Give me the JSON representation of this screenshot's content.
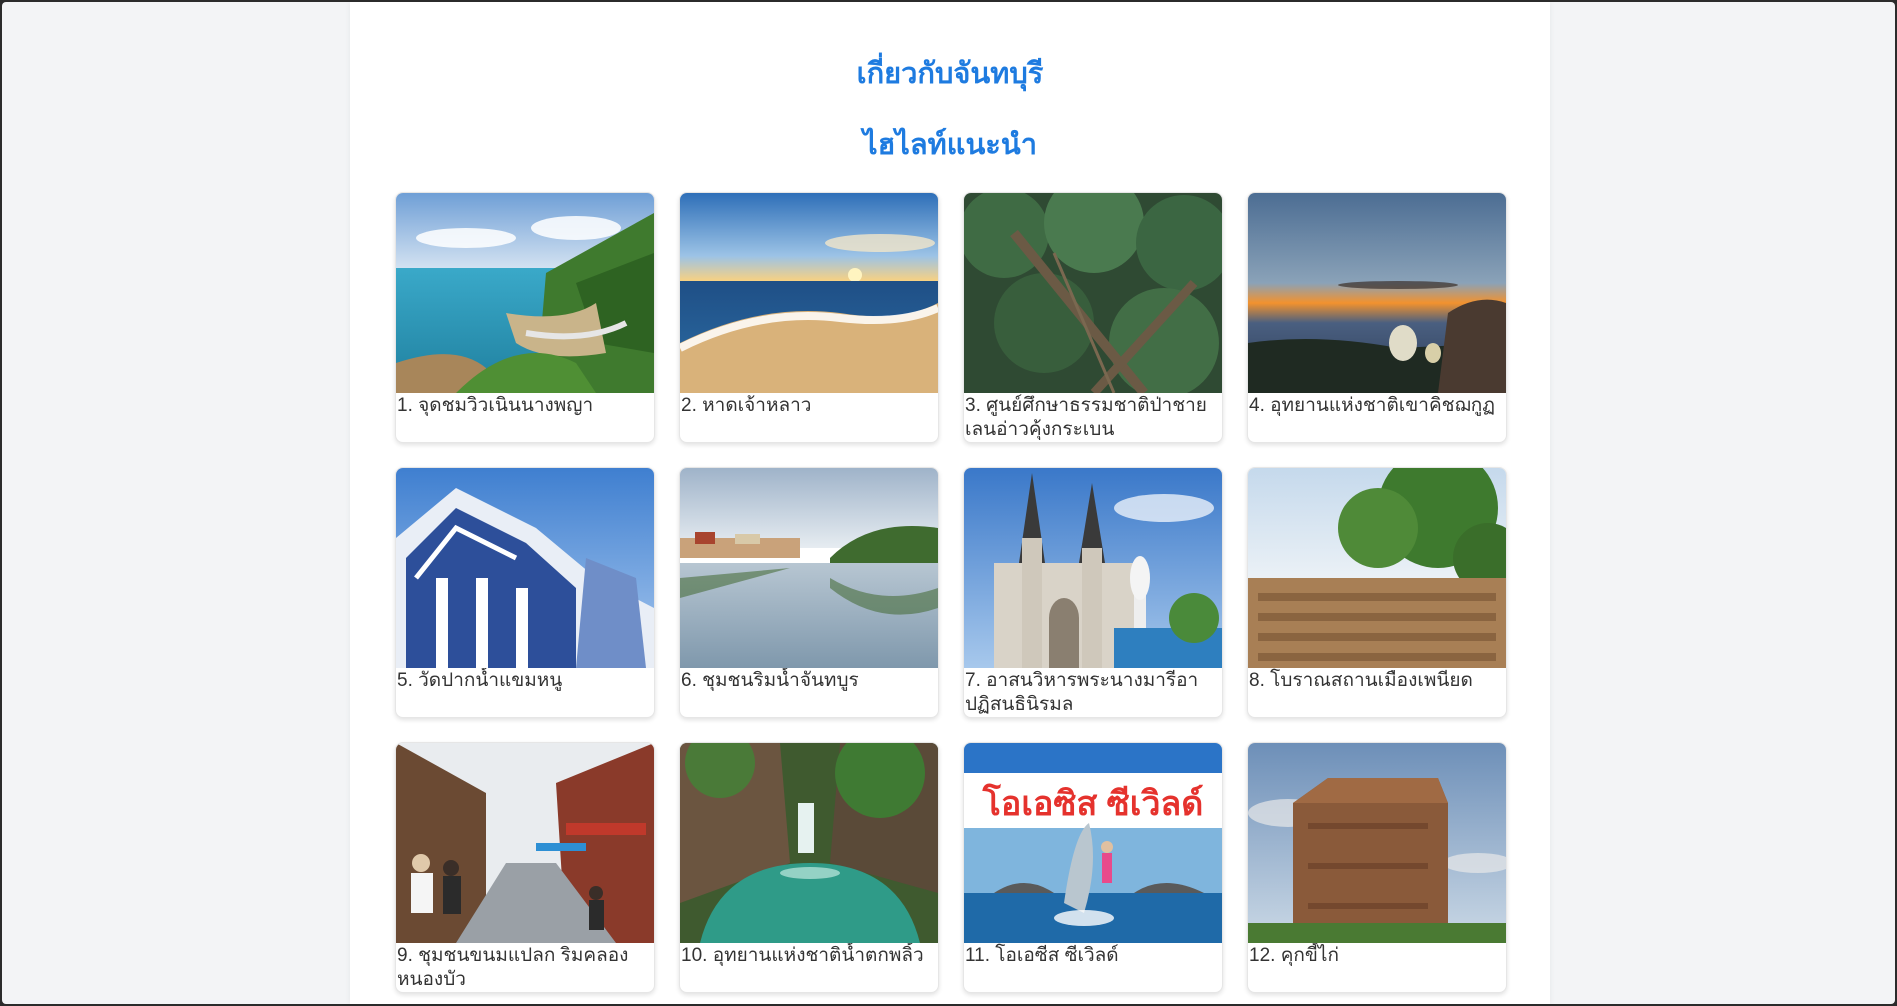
{
  "page": {
    "heading": "เกี่ยวกับจันทบุรี",
    "subheading": "ไฮไลท์แนะนำ"
  },
  "colors": {
    "heading": "#1e7be0",
    "label_text": "#333333",
    "page_bg": "#f3f4f6"
  },
  "highlights": [
    {
      "label": "1. จุดชมวิวเนินนางพญา",
      "image": "coastal-road-cliff-photo"
    },
    {
      "label": "2. หาดเจ้าหลาว",
      "image": "beach-sunset-photo"
    },
    {
      "label": "3. ศูนย์ศึกษาธรรมชาติป่าชายเลนอ่าวคุ้งกระเบน",
      "image": "mangrove-walkway-photo"
    },
    {
      "label": "4. อุทยานแห่งชาติเขาคิชฌกูฏ",
      "image": "mountain-dusk-photo"
    },
    {
      "label": "5. วัดปากน้ำแขมหนู",
      "image": "blue-white-temple-photo"
    },
    {
      "label": "6. ชุมชนริมน้ำจันทบูร",
      "image": "riverside-community-photo"
    },
    {
      "label": "7. อาสนวิหารพระนางมารีอาปฏิสนธินิรมล",
      "image": "cathedral-photo"
    },
    {
      "label": "8. โบราณสถานเมืองเพนียด",
      "image": "ancient-ruins-photo"
    },
    {
      "label": "9. ชุมชนขนมแปลก ริมคลองหนองบัว",
      "image": "street-market-photo"
    },
    {
      "label": "10. อุทยานแห่งชาติน้ำตกพลิ้ว",
      "image": "waterfall-pool-photo"
    },
    {
      "label": "11. โอเอซีส ซีเวิลด์",
      "image": "dolphin-show-photo"
    },
    {
      "label": "12. คุกขี้ไก่",
      "image": "brick-tower-photo"
    }
  ],
  "sign_text": "โอเอซิส ซีเวิลด์"
}
